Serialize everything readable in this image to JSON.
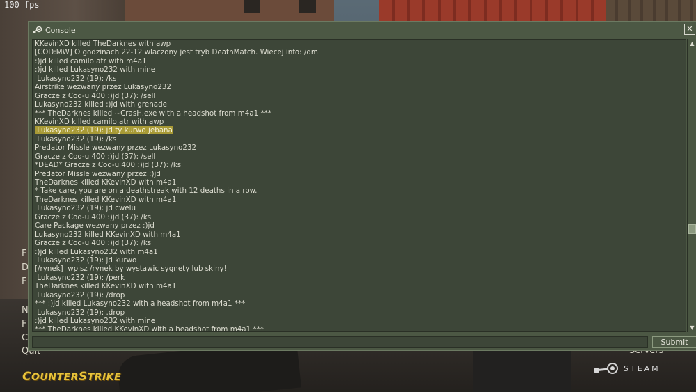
{
  "hud": {
    "fps": "100 fps"
  },
  "menu_peek": [
    "F",
    "D",
    "F",
    "N",
    "F",
    "C",
    "Quit"
  ],
  "servers_label": "Servers",
  "logo": {
    "part1": "C",
    "part2": "OUNTER",
    "part3": "S",
    "part4": "TRIKE"
  },
  "steam_label": "STEAM",
  "console": {
    "title": "Console",
    "close_glyph": "✕",
    "submit_label": "Submit",
    "input_value": "",
    "lines": [
      "KKevinXD killed TheDarknes with awp",
      "[COD:MW] O godzinach 22-12 wlaczony jest tryb DeathMatch. Wiecej info: /dm",
      ":)jd killed camilo atr with m4a1",
      ":)jd killed Lukasyno232 with mine",
      " Lukasyno232 (19): /ks",
      "Airstrike wezwany przez Lukasyno232",
      "Gracze z Cod-u 400 :)jd (37): /sell",
      "Lukasyno232 killed :)jd with grenade",
      "*** TheDarknes killed ~CrasH.exe with a headshot from m4a1 ***",
      "KKevinXD killed camilo atr with awp",
      " Lukasyno232 (19): jd ty kurwo jebana",
      " Lukasyno232 (19): /ks",
      "Predator Missle wezwany przez Lukasyno232",
      "Gracze z Cod-u 400 :)jd (37): /sell",
      "*DEAD* Gracze z Cod-u 400 :)jd (37): /ks",
      "Predator Missle wezwany przez :)jd",
      "TheDarknes killed KKevinXD with m4a1",
      "* Take care, you are on a deathstreak with 12 deaths in a row.",
      "TheDarknes killed KKevinXD with m4a1",
      " Lukasyno232 (19): jd cwelu",
      "Gracze z Cod-u 400 :)jd (37): /ks",
      "Care Package wezwany przez :)jd",
      "Lukasyno232 killed KKevinXD with m4a1",
      "Gracze z Cod-u 400 :)jd (37): /ks",
      ":)jd killed Lukasyno232 with m4a1",
      " Lukasyno232 (19): jd kurwo",
      "[/rynek]  wpisz /rynek by wystawic sygnety lub skiny!",
      " Lukasyno232 (19): /perk",
      "TheDarknes killed KKevinXD with m4a1",
      " Lukasyno232 (19): /drop",
      "*** :)jd killed Lukasyno232 with a headshot from m4a1 ***",
      " Lukasyno232 (19): .drop",
      ":)jd killed Lukasyno232 with mine",
      "*** TheDarknes killed KKevinXD with a headshot from m4a1 ***"
    ],
    "highlighted_line": 10
  }
}
